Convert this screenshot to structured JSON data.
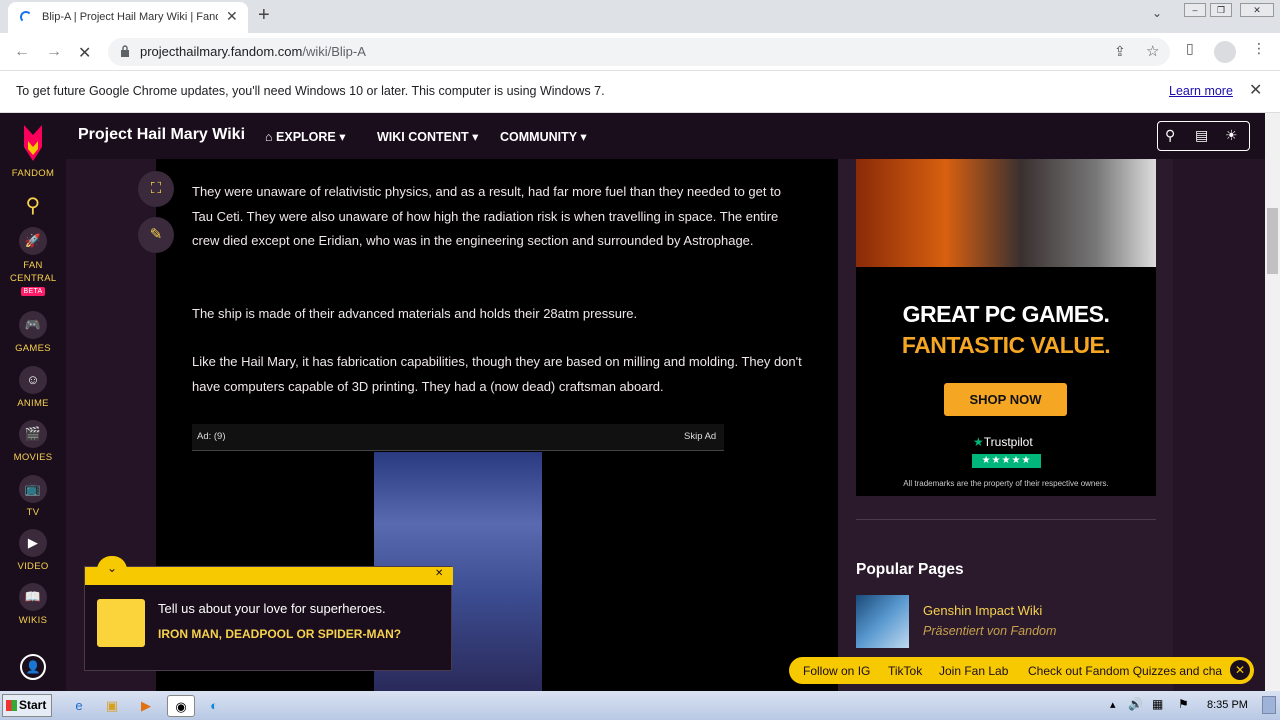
{
  "browser": {
    "tab_title": "Blip-A | Project Hail Mary Wiki | Fandom",
    "url_domain": "projecthailmary.fandom.com",
    "url_path": "/wiki/Blip-A",
    "infobar_message": "To get future Google Chrome updates, you'll need Windows 10 or later. This computer is using Windows 7.",
    "infobar_link": "Learn more"
  },
  "fandom": {
    "logo_label": "FANDOM",
    "rail": [
      {
        "label": "FAN CENTRAL",
        "badge": "BETA"
      },
      {
        "label": "GAMES"
      },
      {
        "label": "ANIME"
      },
      {
        "label": "MOVIES"
      },
      {
        "label": "TV"
      },
      {
        "label": "VIDEO"
      },
      {
        "label": "WIKIS"
      }
    ],
    "wiki_name": "Project Hail Mary Wiki",
    "nav": {
      "explore": "EXPLORE",
      "wiki_content": "WIKI CONTENT",
      "community": "COMMUNITY"
    }
  },
  "article": {
    "p1": "They were unaware of relativistic physics, and as a result, had far more fuel than they needed to get to Tau Ceti. They were also unaware of how high the radiation risk is when travelling in space. The entire crew died except one Eridian, who was in the engineering section and surrounded by Astrophage.",
    "p2": "The ship is made of their advanced materials and holds their 28atm pressure.",
    "p3": "Like the Hail Mary, it has fabrication capabilities, though they are based on milling and molding. They don't have computers capable of 3D printing. They had a (now dead) craftsman aboard.",
    "ad_label": "Ad: (9)",
    "ad_skip": "Skip Ad"
  },
  "promo": {
    "line1": "GREAT PC GAMES.",
    "line2": "FANTASTIC VALUE.",
    "button": "SHOP NOW",
    "trustpilot": "Trustpilot",
    "stars": "★★★★★",
    "trademark": "All trademarks are the property of their respective owners."
  },
  "popular": {
    "title": "Popular Pages",
    "item_title": "Genshin Impact Wiki",
    "item_sub": "Präsentiert von Fandom"
  },
  "quiz": {
    "question": "Tell us about your love for superheroes.",
    "answer": "IRON MAN, DEADPOOL OR SPIDER-MAN?"
  },
  "footer_bar": {
    "ig": "Follow on IG",
    "tiktok": "TikTok",
    "fanlab": "Join Fan Lab",
    "quizzes": "Check out Fandom Quizzes and cha"
  },
  "taskbar": {
    "start": "Start",
    "clock": "8:35 PM"
  },
  "colors": {
    "fandom_yellow": "#f7d24d",
    "fandom_bg": "#241426",
    "promo_orange": "#f5a623"
  }
}
